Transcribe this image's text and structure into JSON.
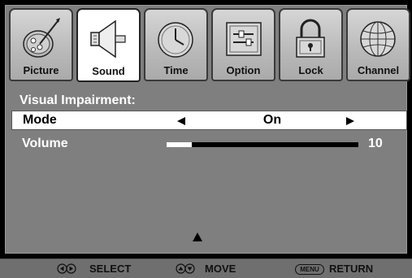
{
  "tabs": [
    {
      "label": "Picture",
      "icon": "picture-dial-icon",
      "active": false
    },
    {
      "label": "Sound",
      "icon": "speaker-icon",
      "active": true
    },
    {
      "label": "Time",
      "icon": "clock-icon",
      "active": false
    },
    {
      "label": "Option",
      "icon": "option-panel-icon",
      "active": false
    },
    {
      "label": "Lock",
      "icon": "padlock-icon",
      "active": false
    },
    {
      "label": "Channel",
      "icon": "globe-icon",
      "active": false
    }
  ],
  "menu": {
    "heading": "Visual Impairment:",
    "mode": {
      "label": "Mode",
      "value": "On"
    },
    "volume": {
      "label": "Volume",
      "value": "10",
      "fraction": 0.13
    }
  },
  "footer": {
    "select_label": "SELECT",
    "move_label": "MOVE",
    "menu_key": "MENU",
    "return_label": "RETURN"
  },
  "colors": {
    "panel": "#7f7f7f",
    "background": "#000000",
    "highlight": "#ffffff"
  }
}
